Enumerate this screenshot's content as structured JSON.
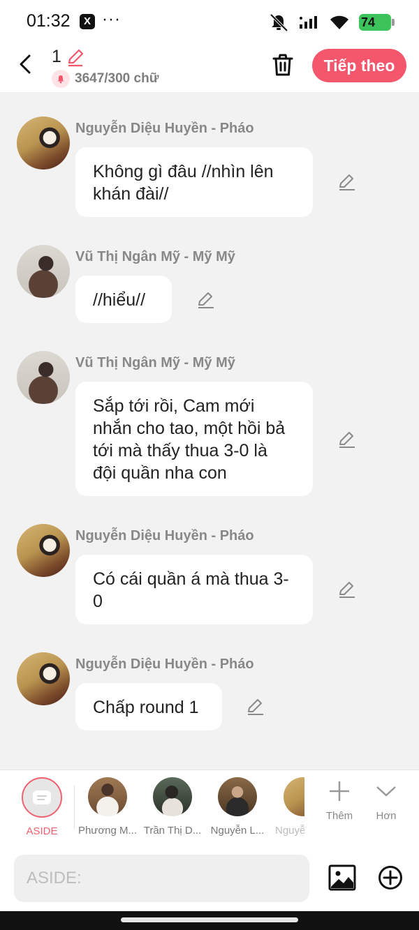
{
  "status_bar": {
    "time": "01:32",
    "app_badge": "X",
    "more": "···",
    "battery": "74"
  },
  "header": {
    "title": "1",
    "word_count": "3647/300 chữ",
    "next_label": "Tiếp theo"
  },
  "messages": [
    {
      "sender": "Nguyễn Diệu Huyền - Pháo",
      "text": "Không gì đâu //nhìn lên khán đài//"
    },
    {
      "sender": "Vũ Thị Ngân Mỹ - Mỹ Mỹ",
      "text": "//hiểu//"
    },
    {
      "sender": "Vũ Thị Ngân Mỹ - Mỹ Mỹ",
      "text": "Sắp tới rồi, Cam mới nhắn cho tao, một hồi bả tới mà thấy thua 3-0 là đội quần nha con"
    },
    {
      "sender": "Nguyễn Diệu Huyền - Pháo",
      "text": "Có cái quần á mà thua 3-0"
    },
    {
      "sender": "Nguyễn Diệu Huyền - Pháo",
      "text": "Chấp round 1"
    }
  ],
  "characters": {
    "aside_label": "ASIDE",
    "items": [
      "Phương M...",
      "Trần Thị D...",
      "Nguyễn L...",
      "Nguyễ"
    ],
    "add_label": "Thêm",
    "more_label": "Hơn"
  },
  "input": {
    "placeholder": "ASIDE:"
  },
  "colors": {
    "accent": "#f4566c",
    "background": "#f2f2f2",
    "bubble": "#ffffff"
  }
}
